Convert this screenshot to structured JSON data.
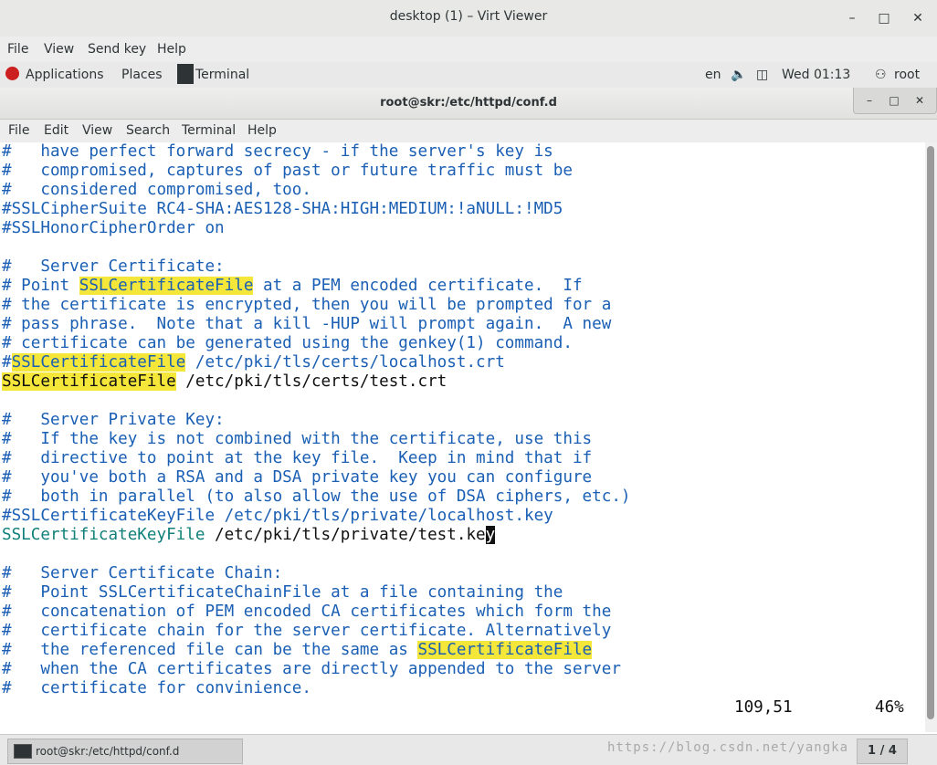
{
  "viewer": {
    "title": "desktop (1) – Virt Viewer",
    "menu": [
      "File",
      "View",
      "Send key",
      "Help"
    ]
  },
  "topbar": {
    "applications": "Applications",
    "places": "Places",
    "terminal": "Terminal",
    "lang": "en",
    "clock": "Wed 01:13",
    "user": "root"
  },
  "terminal": {
    "title": "root@skr:/etc/httpd/conf.d",
    "menu": [
      "File",
      "Edit",
      "View",
      "Search",
      "Terminal",
      "Help"
    ],
    "lines": [
      "#   have perfect forward secrecy - if the server's key is",
      "#   compromised, captures of past or future traffic must be",
      "#   considered compromised, too.",
      "#SSLCipherSuite RC4-SHA:AES128-SHA:HIGH:MEDIUM:!aNULL:!MD5",
      "#SSLHonorCipherOrder on",
      "",
      "#   Server Certificate:",
      "# Point ",
      "SSLCertificateFile",
      " at a PEM encoded certificate.  If",
      "# the certificate is encrypted, then you will be prompted for a",
      "# pass phrase.  Note that a kill -HUP will prompt again.  A new",
      "# certificate can be generated using the genkey(1) command.",
      "#",
      " /etc/pki/tls/certs/localhost.crt",
      " /etc/pki/tls/certs/test.crt",
      "#   Server Private Key:",
      "#   If the key is not combined with the certificate, use this",
      "#   directive to point at the key file.  Keep in mind that if",
      "#   you've both a RSA and a DSA private key you can configure",
      "#   both in parallel (to also allow the use of DSA ciphers, etc.)",
      "#SSLCertificateKeyFile /etc/pki/tls/private/localhost.key",
      "SSLCertificateKeyFile",
      " /etc/pki/tls/private/test.ke",
      "y",
      "#   Server Certificate Chain:",
      "#   Point SSLCertificateChainFile at a file containing the",
      "#   concatenation of PEM encoded CA certificates which form the",
      "#   certificate chain for the server certificate. Alternatively",
      "#   the referenced file can be the same as ",
      "#   when the CA certificates are directly appended to the server",
      "#   certificate for convinience."
    ],
    "status_position": "109,51",
    "status_percent": "46%"
  },
  "taskbar": {
    "task": "root@skr:/etc/httpd/conf.d",
    "workspace": "1 / 4",
    "watermark": "https://blog.csdn.net/yangka"
  },
  "colors": {
    "comment": "#1a5fb4",
    "keyword": "#11807a",
    "highlight": "#f5e63a"
  }
}
